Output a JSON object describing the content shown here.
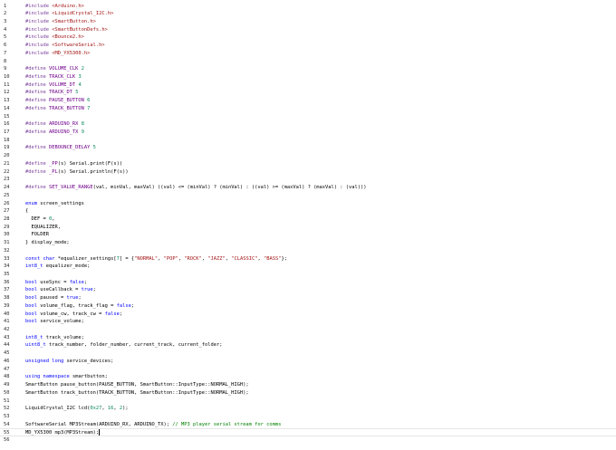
{
  "colors": {
    "background": "#ffffff",
    "line_number": "#2b2b2b",
    "directive": "#7a3e9d",
    "string": "#a31515",
    "keyword": "#0000ff",
    "number": "#098658",
    "comment": "#008000",
    "macro": "#6f008a",
    "plain": "#000000"
  },
  "editor": {
    "current_line": 55,
    "lines": [
      {
        "n": "1",
        "tokens": [
          {
            "k": "dir",
            "t": "#include "
          },
          {
            "k": "inc",
            "t": "<Arduino.h>"
          }
        ]
      },
      {
        "n": "2",
        "tokens": [
          {
            "k": "dir",
            "t": "#include "
          },
          {
            "k": "inc",
            "t": "<LiquidCrystal_I2C.h>"
          }
        ]
      },
      {
        "n": "3",
        "tokens": [
          {
            "k": "dir",
            "t": "#include "
          },
          {
            "k": "inc",
            "t": "<SmartButton.h>"
          }
        ]
      },
      {
        "n": "4",
        "tokens": [
          {
            "k": "dir",
            "t": "#include "
          },
          {
            "k": "inc",
            "t": "<SmartButtonDefs.h>"
          }
        ]
      },
      {
        "n": "5",
        "tokens": [
          {
            "k": "dir",
            "t": "#include "
          },
          {
            "k": "inc",
            "t": "<Bounce2.h>"
          }
        ]
      },
      {
        "n": "6",
        "tokens": [
          {
            "k": "dir",
            "t": "#include "
          },
          {
            "k": "inc",
            "t": "<SoftwareSerial.h>"
          }
        ]
      },
      {
        "n": "7",
        "tokens": [
          {
            "k": "dir",
            "t": "#include "
          },
          {
            "k": "inc",
            "t": "<MD_YX5300.h>"
          }
        ]
      },
      {
        "n": "8",
        "tokens": []
      },
      {
        "n": "9",
        "tokens": [
          {
            "k": "dir",
            "t": "#define "
          },
          {
            "k": "mac",
            "t": "VOLUME_CLK"
          },
          {
            "k": "id",
            "t": " "
          },
          {
            "k": "num",
            "t": "2"
          }
        ]
      },
      {
        "n": "10",
        "tokens": [
          {
            "k": "dir",
            "t": "#define "
          },
          {
            "k": "mac",
            "t": "TRACK_CLK"
          },
          {
            "k": "id",
            "t": " "
          },
          {
            "k": "num",
            "t": "3"
          }
        ]
      },
      {
        "n": "11",
        "tokens": [
          {
            "k": "dir",
            "t": "#define "
          },
          {
            "k": "mac",
            "t": "VOLUME_DT"
          },
          {
            "k": "id",
            "t": " "
          },
          {
            "k": "num",
            "t": "4"
          }
        ]
      },
      {
        "n": "12",
        "tokens": [
          {
            "k": "dir",
            "t": "#define "
          },
          {
            "k": "mac",
            "t": "TRACK_DT"
          },
          {
            "k": "id",
            "t": " "
          },
          {
            "k": "num",
            "t": "5"
          }
        ]
      },
      {
        "n": "13",
        "tokens": [
          {
            "k": "dir",
            "t": "#define "
          },
          {
            "k": "mac",
            "t": "PAUSE_BUTTON"
          },
          {
            "k": "id",
            "t": " "
          },
          {
            "k": "num",
            "t": "6"
          }
        ]
      },
      {
        "n": "14",
        "tokens": [
          {
            "k": "dir",
            "t": "#define "
          },
          {
            "k": "mac",
            "t": "TRACK_BUTTON"
          },
          {
            "k": "id",
            "t": " "
          },
          {
            "k": "num",
            "t": "7"
          }
        ]
      },
      {
        "n": "15",
        "tokens": []
      },
      {
        "n": "16",
        "tokens": [
          {
            "k": "dir",
            "t": "#define "
          },
          {
            "k": "mac",
            "t": "ARDUINO_RX"
          },
          {
            "k": "id",
            "t": " "
          },
          {
            "k": "num",
            "t": "8"
          }
        ]
      },
      {
        "n": "17",
        "tokens": [
          {
            "k": "dir",
            "t": "#define "
          },
          {
            "k": "mac",
            "t": "ARDUINO_TX"
          },
          {
            "k": "id",
            "t": " "
          },
          {
            "k": "num",
            "t": "9"
          }
        ]
      },
      {
        "n": "18",
        "tokens": []
      },
      {
        "n": "19",
        "tokens": [
          {
            "k": "dir",
            "t": "#define "
          },
          {
            "k": "mac",
            "t": "DEBOUNCE_DELAY"
          },
          {
            "k": "id",
            "t": " "
          },
          {
            "k": "num",
            "t": "5"
          }
        ]
      },
      {
        "n": "20",
        "tokens": []
      },
      {
        "n": "21",
        "tokens": [
          {
            "k": "dir",
            "t": "#define "
          },
          {
            "k": "mac",
            "t": "_PP"
          },
          {
            "k": "id",
            "t": "(s) Serial.print(F(s))"
          }
        ]
      },
      {
        "n": "22",
        "tokens": [
          {
            "k": "dir",
            "t": "#define "
          },
          {
            "k": "mac",
            "t": "_PL"
          },
          {
            "k": "id",
            "t": "(s) Serial.println(F(s))"
          }
        ]
      },
      {
        "n": "23",
        "tokens": []
      },
      {
        "n": "24",
        "tokens": [
          {
            "k": "dir",
            "t": "#define "
          },
          {
            "k": "mac",
            "t": "SET_VALUE_RANGE"
          },
          {
            "k": "id",
            "t": "(val, minVal, maxVal) ((val) <= (minVal) ? (minVal) : ((val) >= (maxVal) ? (maxVal) : (val)))"
          }
        ]
      },
      {
        "n": "25",
        "tokens": []
      },
      {
        "n": "26",
        "tokens": [
          {
            "k": "kw",
            "t": "enum"
          },
          {
            "k": "id",
            "t": " screen_settings"
          }
        ]
      },
      {
        "n": "27",
        "tokens": [
          {
            "k": "id",
            "t": "{"
          }
        ]
      },
      {
        "n": "28",
        "tokens": [
          {
            "k": "id",
            "t": "  DEF = "
          },
          {
            "k": "num",
            "t": "0"
          },
          {
            "k": "id",
            "t": ","
          }
        ]
      },
      {
        "n": "29",
        "tokens": [
          {
            "k": "id",
            "t": "  EQUALIZER,"
          }
        ]
      },
      {
        "n": "30",
        "tokens": [
          {
            "k": "id",
            "t": "  FOLDER"
          }
        ]
      },
      {
        "n": "31",
        "tokens": [
          {
            "k": "id",
            "t": "} display_mode;"
          }
        ]
      },
      {
        "n": "32",
        "tokens": []
      },
      {
        "n": "33",
        "tokens": [
          {
            "k": "kw",
            "t": "const"
          },
          {
            "k": "id",
            "t": " "
          },
          {
            "k": "kw",
            "t": "char"
          },
          {
            "k": "id",
            "t": " *equalizer_settings["
          },
          {
            "k": "num",
            "t": "7"
          },
          {
            "k": "id",
            "t": "] = {"
          },
          {
            "k": "str",
            "t": "\"NORMAL\""
          },
          {
            "k": "id",
            "t": ", "
          },
          {
            "k": "str",
            "t": "\"POP\""
          },
          {
            "k": "id",
            "t": ", "
          },
          {
            "k": "str",
            "t": "\"ROCK\""
          },
          {
            "k": "id",
            "t": ", "
          },
          {
            "k": "str",
            "t": "\"JAZZ\""
          },
          {
            "k": "id",
            "t": ", "
          },
          {
            "k": "str",
            "t": "\"CLASSIC\""
          },
          {
            "k": "id",
            "t": ", "
          },
          {
            "k": "str",
            "t": "\"BASS\""
          },
          {
            "k": "id",
            "t": "};"
          }
        ]
      },
      {
        "n": "34",
        "tokens": [
          {
            "k": "type",
            "t": "int8_t"
          },
          {
            "k": "id",
            "t": " equalizer_mode;"
          }
        ]
      },
      {
        "n": "35",
        "tokens": []
      },
      {
        "n": "36",
        "tokens": [
          {
            "k": "type",
            "t": "bool"
          },
          {
            "k": "id",
            "t": " useSync = "
          },
          {
            "k": "kw",
            "t": "false"
          },
          {
            "k": "id",
            "t": ";"
          }
        ]
      },
      {
        "n": "37",
        "tokens": [
          {
            "k": "type",
            "t": "bool"
          },
          {
            "k": "id",
            "t": " useCallback = "
          },
          {
            "k": "kw",
            "t": "true"
          },
          {
            "k": "id",
            "t": ";"
          }
        ]
      },
      {
        "n": "38",
        "tokens": [
          {
            "k": "type",
            "t": "bool"
          },
          {
            "k": "id",
            "t": " paused = "
          },
          {
            "k": "kw",
            "t": "true"
          },
          {
            "k": "id",
            "t": ";"
          }
        ]
      },
      {
        "n": "39",
        "tokens": [
          {
            "k": "type",
            "t": "bool"
          },
          {
            "k": "id",
            "t": " volume_flag, track_flag = "
          },
          {
            "k": "kw",
            "t": "false"
          },
          {
            "k": "id",
            "t": ";"
          }
        ]
      },
      {
        "n": "40",
        "tokens": [
          {
            "k": "type",
            "t": "bool"
          },
          {
            "k": "id",
            "t": " volume_cw, track_cw = "
          },
          {
            "k": "kw",
            "t": "false"
          },
          {
            "k": "id",
            "t": ";"
          }
        ]
      },
      {
        "n": "41",
        "tokens": [
          {
            "k": "type",
            "t": "bool"
          },
          {
            "k": "id",
            "t": " service_volume;"
          }
        ]
      },
      {
        "n": "42",
        "tokens": []
      },
      {
        "n": "43",
        "tokens": [
          {
            "k": "type",
            "t": "int8_t"
          },
          {
            "k": "id",
            "t": " track_volume;"
          }
        ]
      },
      {
        "n": "44",
        "tokens": [
          {
            "k": "type",
            "t": "uint8_t"
          },
          {
            "k": "id",
            "t": " track_number, folder_number, current_track, current_folder;"
          }
        ]
      },
      {
        "n": "45",
        "tokens": []
      },
      {
        "n": "46",
        "tokens": [
          {
            "k": "kw",
            "t": "unsigned"
          },
          {
            "k": "id",
            "t": " "
          },
          {
            "k": "kw",
            "t": "long"
          },
          {
            "k": "id",
            "t": " service_devices;"
          }
        ]
      },
      {
        "n": "47",
        "tokens": []
      },
      {
        "n": "48",
        "tokens": [
          {
            "k": "kw",
            "t": "using"
          },
          {
            "k": "id",
            "t": " "
          },
          {
            "k": "kw",
            "t": "namespace"
          },
          {
            "k": "id",
            "t": " smartbutton;"
          }
        ]
      },
      {
        "n": "49",
        "tokens": [
          {
            "k": "id",
            "t": "SmartButton pause_button(PAUSE_BUTTON, SmartButton::InputType::NORMAL_HIGH);"
          }
        ]
      },
      {
        "n": "50",
        "tokens": [
          {
            "k": "id",
            "t": "SmartButton track_button(TRACK_BUTTON, SmartButton::InputType::NORMAL_HIGH);"
          }
        ]
      },
      {
        "n": "51",
        "tokens": []
      },
      {
        "n": "52",
        "tokens": [
          {
            "k": "id",
            "t": "LiquidCrystal_I2C lcd("
          },
          {
            "k": "num",
            "t": "0x27"
          },
          {
            "k": "id",
            "t": ", "
          },
          {
            "k": "num",
            "t": "16"
          },
          {
            "k": "id",
            "t": ", "
          },
          {
            "k": "num",
            "t": "2"
          },
          {
            "k": "id",
            "t": ");"
          }
        ]
      },
      {
        "n": "53",
        "tokens": []
      },
      {
        "n": "54",
        "tokens": [
          {
            "k": "id",
            "t": "SoftwareSerial MP3Stream(ARDUINO_RX, ARDUINO_TX); "
          },
          {
            "k": "cmt",
            "t": "// MP3 player serial stream for comms"
          }
        ]
      },
      {
        "n": "55",
        "tokens": [
          {
            "k": "id",
            "t": "MD_YX5300 mp3(MP3Stream);"
          }
        ]
      },
      {
        "n": "56",
        "tokens": []
      }
    ]
  }
}
